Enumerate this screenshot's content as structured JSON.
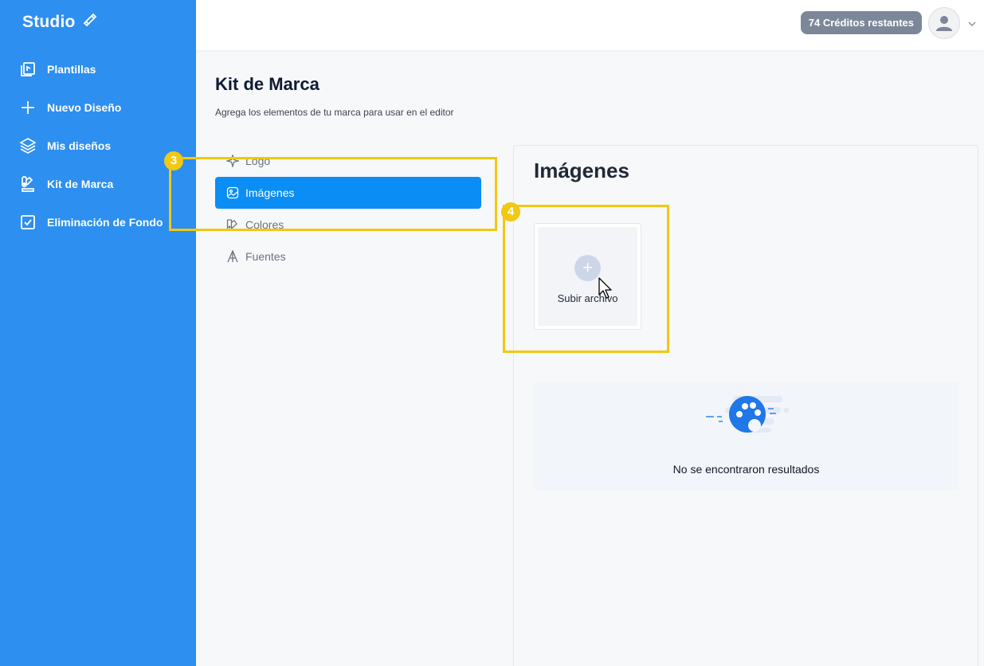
{
  "brand": {
    "name": "Studio",
    "brand_color": "#2d8fef"
  },
  "sidebar": {
    "items": [
      {
        "label": "Plantillas",
        "icon": "templates-icon"
      },
      {
        "label": "Nuevo Diseño",
        "icon": "plus-icon"
      },
      {
        "label": "Mis diseños",
        "icon": "layers-icon"
      },
      {
        "label": "Kit de Marca",
        "icon": "brand-kit-icon"
      },
      {
        "label": "Eliminación de Fondo",
        "icon": "checkbox-icon"
      }
    ]
  },
  "header": {
    "credits": "74 Créditos restantes"
  },
  "page": {
    "title": "Kit de Marca",
    "subtitle": "Agrega los elementos de tu marca para usar en el editor"
  },
  "menu": {
    "items": [
      {
        "label": "Logo",
        "icon": "sparkle-icon",
        "active": false
      },
      {
        "label": "Imágenes",
        "icon": "image-icon",
        "active": true
      },
      {
        "label": "Colores",
        "icon": "palette-icon",
        "active": false
      },
      {
        "label": "Fuentes",
        "icon": "font-icon",
        "active": false
      }
    ]
  },
  "content": {
    "title": "Imágenes",
    "upload_label": "Subir archivo",
    "empty_text": "No se encontraron resultados"
  },
  "annotations": {
    "badge_3": "3",
    "badge_4": "4",
    "highlight_color": "#f2c811"
  }
}
